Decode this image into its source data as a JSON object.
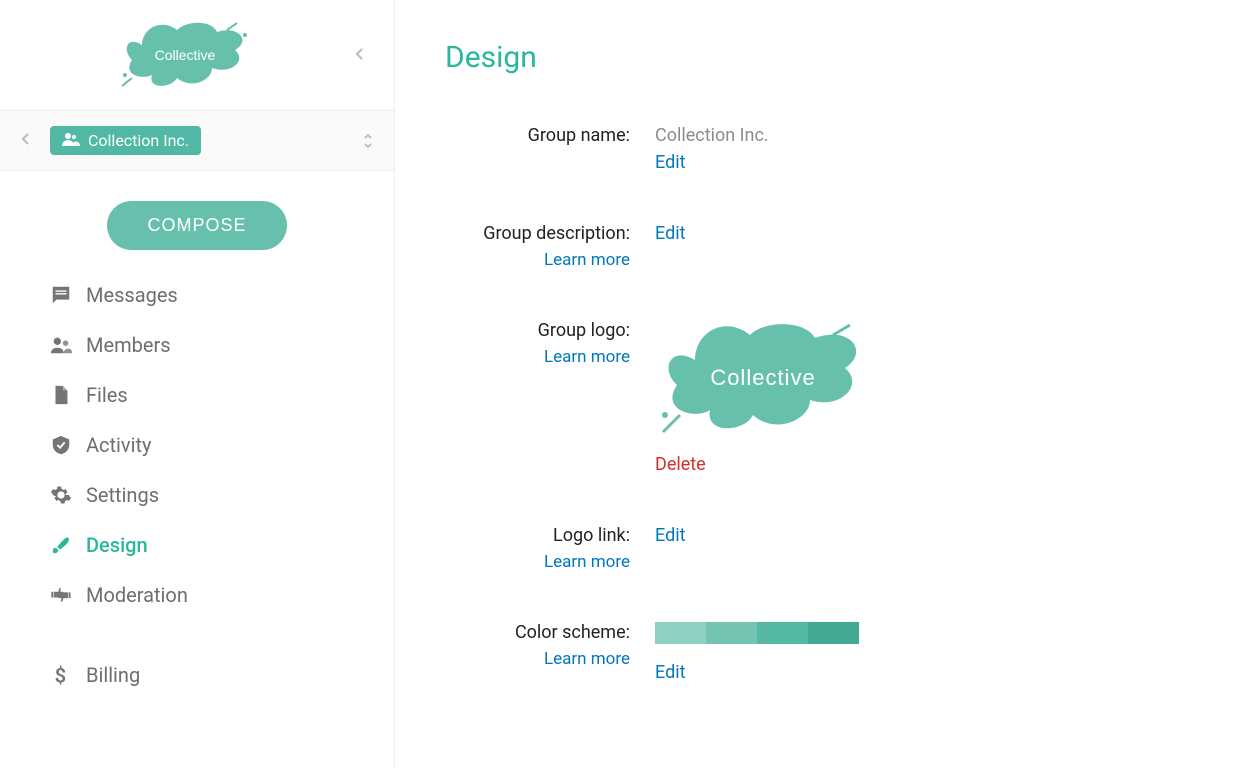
{
  "brand": {
    "logo_text": "Collective",
    "logo_color": "#67c0ac"
  },
  "group_selector": {
    "group_name": "Collection Inc."
  },
  "compose": {
    "label": "COMPOSE"
  },
  "nav": {
    "items": [
      {
        "id": "messages",
        "label": "Messages",
        "icon": "messages-icon"
      },
      {
        "id": "members",
        "label": "Members",
        "icon": "members-icon"
      },
      {
        "id": "files",
        "label": "Files",
        "icon": "file-icon"
      },
      {
        "id": "activity",
        "label": "Activity",
        "icon": "shield-icon"
      },
      {
        "id": "settings",
        "label": "Settings",
        "icon": "gear-icon"
      },
      {
        "id": "design",
        "label": "Design",
        "icon": "brush-icon",
        "active": true
      },
      {
        "id": "moderation",
        "label": "Moderation",
        "icon": "thumbs-icon"
      },
      {
        "id": "billing",
        "label": "Billing",
        "icon": "dollar-icon"
      }
    ]
  },
  "page": {
    "title": "Design",
    "learn_more": "Learn more",
    "edit": "Edit",
    "delete": "Delete",
    "rows": {
      "group_name": {
        "label": "Group name:",
        "value": "Collection Inc."
      },
      "group_description": {
        "label": "Group description:"
      },
      "group_logo": {
        "label": "Group logo:",
        "logo_text": "Collective"
      },
      "logo_link": {
        "label": "Logo link:"
      },
      "color_scheme": {
        "label": "Color scheme:",
        "swatches": [
          "#8ed0c2",
          "#74c4b3",
          "#55b8a3",
          "#43a994"
        ]
      }
    }
  }
}
